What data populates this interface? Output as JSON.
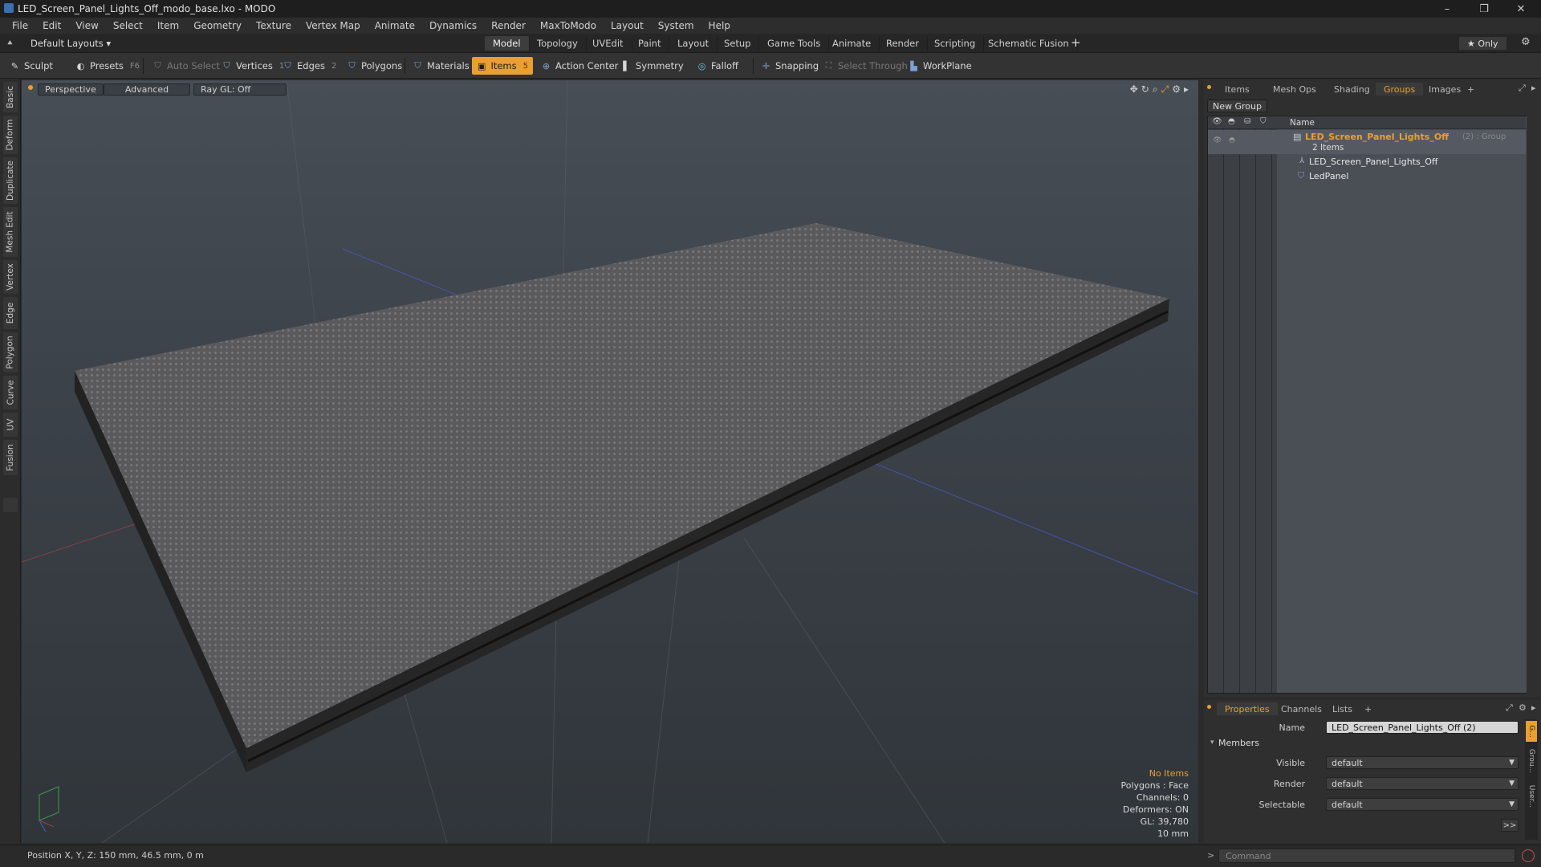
{
  "window": {
    "title": "LED_Screen_Panel_Lights_Off_modo_base.lxo - MODO",
    "controls": {
      "minimize": "–",
      "restore": "❐",
      "close": "✕"
    }
  },
  "menu": [
    "File",
    "Edit",
    "View",
    "Select",
    "Item",
    "Geometry",
    "Texture",
    "Vertex Map",
    "Animate",
    "Dynamics",
    "Render",
    "MaxToModo",
    "Layout",
    "System",
    "Help"
  ],
  "layoutbar": {
    "layout_select": "Default Layouts ▾",
    "tabs": [
      "Model",
      "Topology",
      "UVEdit",
      "Paint",
      "Layout",
      "Setup",
      "Game Tools",
      "Animate",
      "Render",
      "Scripting",
      "Schematic Fusion"
    ],
    "active_tab": "Model",
    "add": "+",
    "only_label": "★  Only",
    "gear": "⚙"
  },
  "toolbar": {
    "sculpt": "Sculpt",
    "presets": "Presets",
    "presets_key": "F6",
    "auto_select": "Auto Select",
    "vertices": "Vertices",
    "vertices_key": "1",
    "edges": "Edges",
    "edges_key": "2",
    "polygons": "Polygons",
    "materials": "Materials",
    "items": "Items",
    "items_key": "5",
    "action_center": "Action Center",
    "symmetry": "Symmetry",
    "falloff": "Falloff",
    "snapping": "Snapping",
    "select_through": "Select Through",
    "workplane": "WorkPlane"
  },
  "left_tabs": [
    "Basic",
    "Deform",
    "Duplicate",
    "Mesh Edit",
    "Vertex",
    "Edge",
    "Polygon",
    "Curve",
    "UV",
    "Fusion"
  ],
  "viewport": {
    "view_mode": "Perspective",
    "shading": "Advanced",
    "raygl": "Ray GL: Off",
    "stats": [
      "No Items",
      "Polygons : Face",
      "Channels: 0",
      "Deformers: ON",
      "GL: 39,780",
      "10 mm"
    ],
    "colors": {
      "accent": "#e8a030",
      "no_items": "#e8a030"
    }
  },
  "right_panel": {
    "tabs": [
      "Items",
      "Mesh Ops",
      "Shading",
      "Groups",
      "Images",
      "+"
    ],
    "active_tab": "Groups",
    "new_group": "New Group",
    "column_name": "Name",
    "group": {
      "name": "LED_Screen_Panel_Lights_Off",
      "suffix": "(2) : Group",
      "count": "2 Items"
    },
    "children": [
      "LED_Screen_Panel_Lights_Off",
      "LedPanel"
    ]
  },
  "properties": {
    "tabs": [
      "Properties",
      "Channels",
      "Lists",
      "+"
    ],
    "active_tab": "Properties",
    "name_label": "Name",
    "name_value": "LED_Screen_Panel_Lights_Off (2)",
    "members": "Members",
    "visible_label": "Visible",
    "visible_value": "default",
    "render_label": "Render",
    "render_value": "default",
    "selectable_label": "Selectable",
    "selectable_value": "default",
    "more": ">>",
    "side_tabs": [
      "G...",
      "Grou...",
      "User..."
    ]
  },
  "statusbar": {
    "position": "Position X, Y, Z:  150 mm, 46.5 mm, 0 m",
    "command_placeholder": "Command",
    "prompt": ">"
  }
}
